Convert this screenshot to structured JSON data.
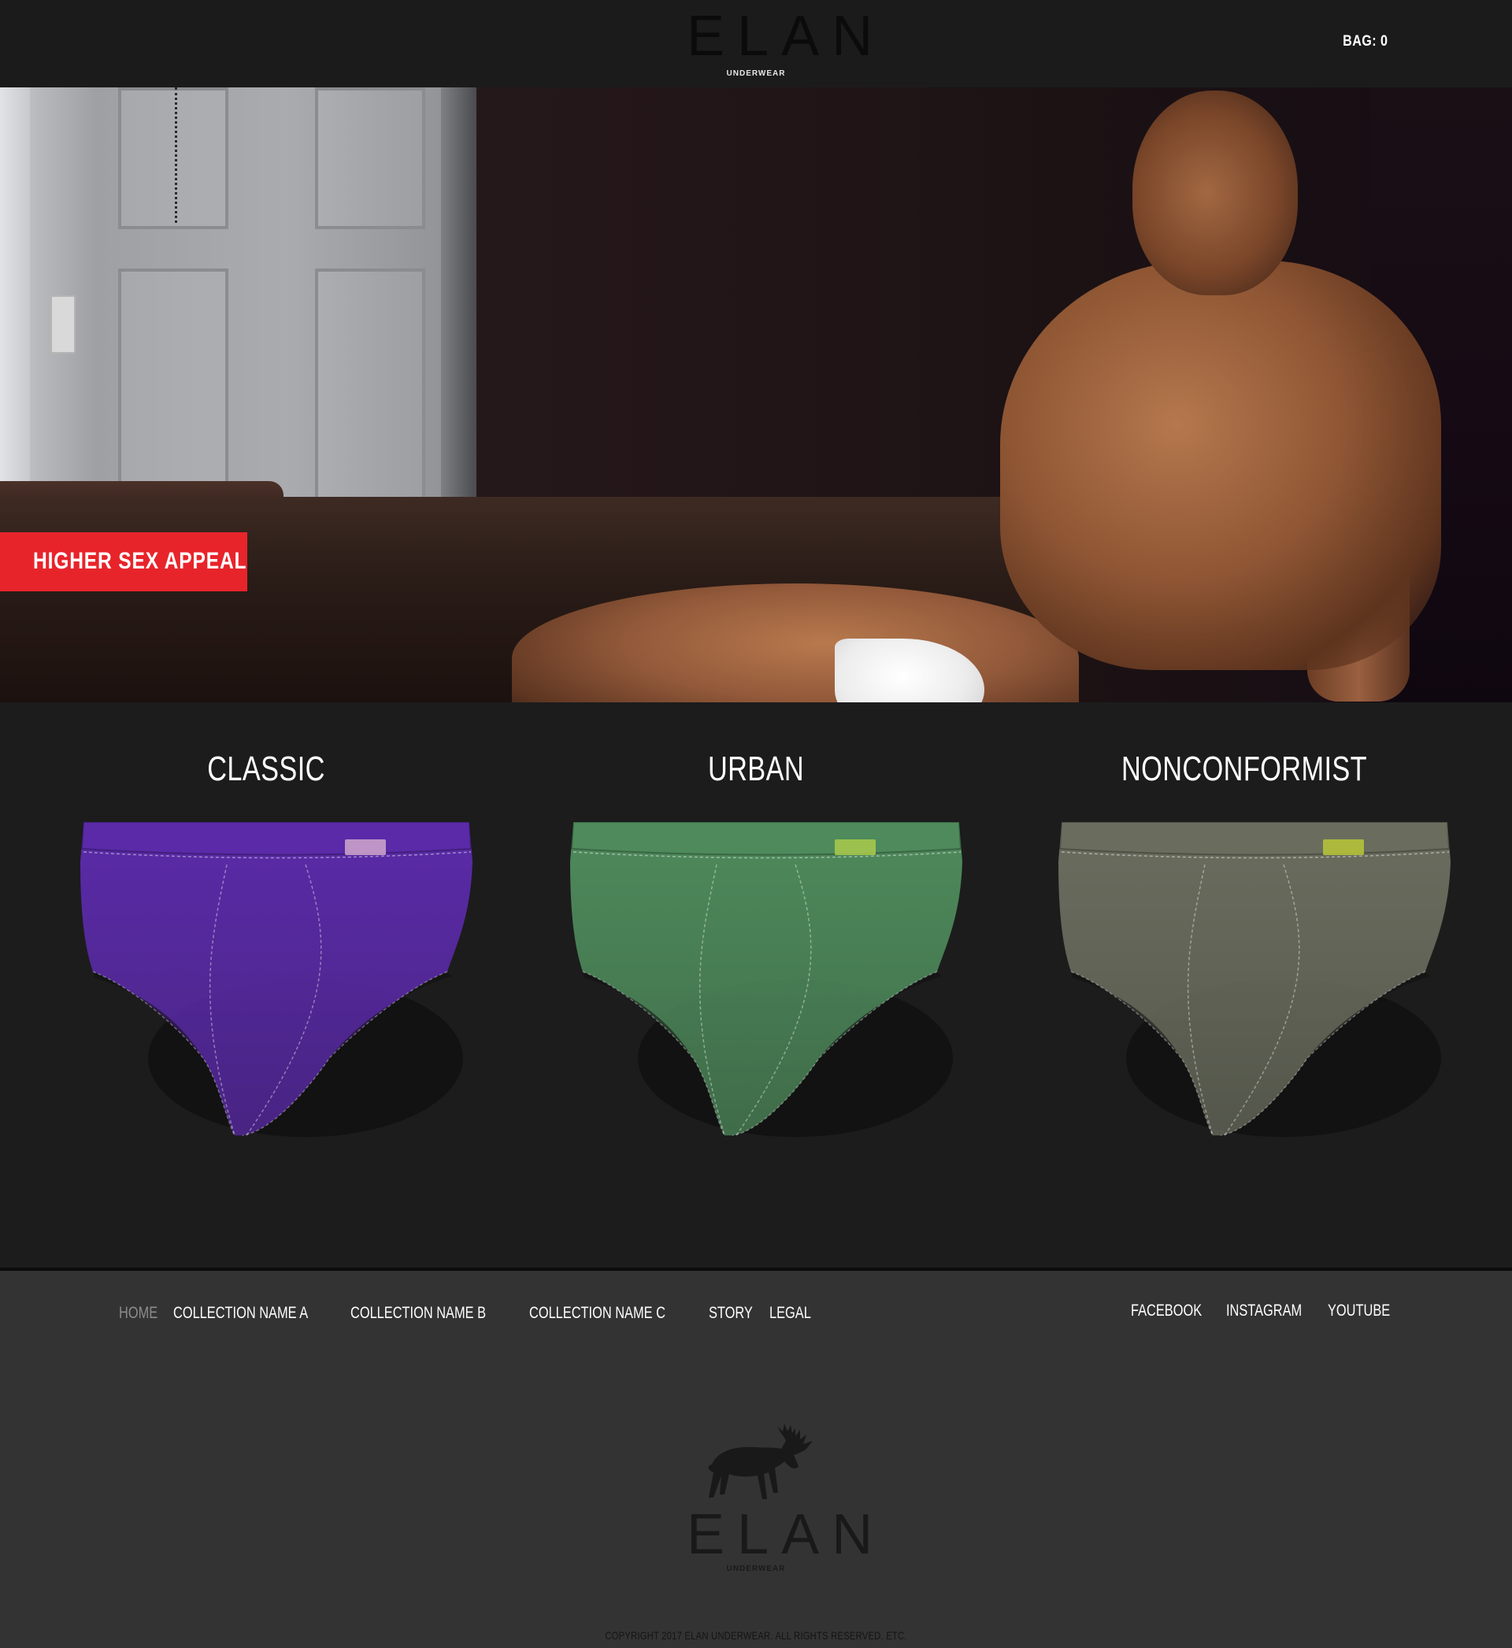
{
  "header": {
    "logo_word": "ELAN",
    "logo_sub": "UNDERWEAR",
    "bag_label": "BAG: 0"
  },
  "hero": {
    "tagline": "HIGHER SEX APPEAL",
    "accent_color": "#e8242b"
  },
  "collections": [
    {
      "title": "CLASSIC",
      "color": "#5a2aa8",
      "label_color": "#c9a1c9"
    },
    {
      "title": "URBAN",
      "color": "#4e8a5b",
      "label_color": "#a6c64c"
    },
    {
      "title": "NONCONFORMIST",
      "color": "#6a6d5e",
      "label_color": "#b5c13a"
    }
  ],
  "footer": {
    "nav": [
      "HOME",
      "COLLECTION NAME A",
      "COLLECTION NAME B",
      "COLLECTION NAME C",
      "STORY",
      "LEGAL"
    ],
    "social": [
      "FACEBOOK",
      "INSTAGRAM",
      "YOUTUBE"
    ],
    "logo_word": "ELAN",
    "logo_sub": "UNDERWEAR",
    "copyright": "COPYRIGHT 2017 ELAN UNDERWEAR. ALL RIGHTS RESERVED. ETC."
  }
}
